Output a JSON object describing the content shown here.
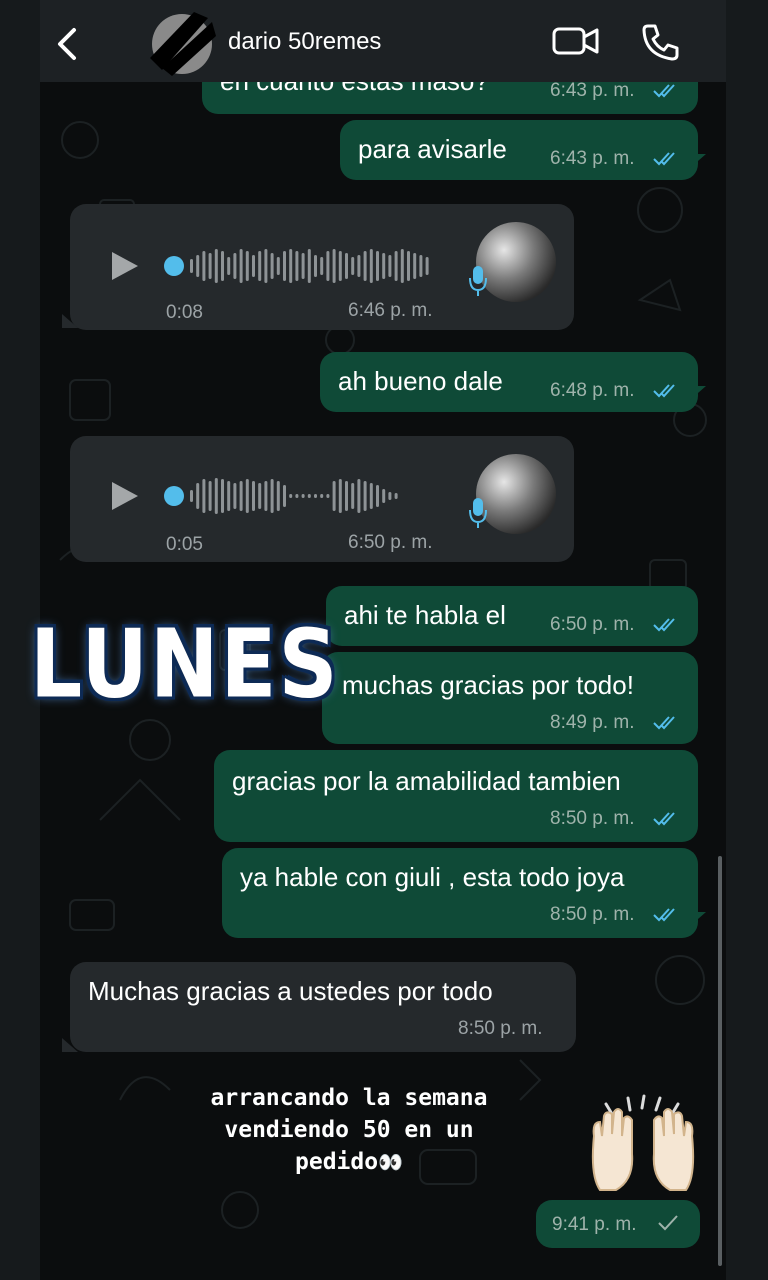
{
  "header": {
    "contact_name": "dario 50remes",
    "icons": {
      "back": "chevron-left-icon",
      "video": "video-camera-icon",
      "call": "phone-icon"
    }
  },
  "messages": [
    {
      "type": "text",
      "direction": "outgoing",
      "text": "en cuanto estas maso?",
      "time": "6:43 p. m.",
      "status": "read"
    },
    {
      "type": "text",
      "direction": "outgoing",
      "text": "para avisarle",
      "time": "6:43 p. m.",
      "status": "read"
    },
    {
      "type": "voice",
      "direction": "incoming",
      "duration": "0:08",
      "time": "6:46 p. m."
    },
    {
      "type": "text",
      "direction": "outgoing",
      "text": "ah bueno dale",
      "time": "6:48 p. m.",
      "status": "read"
    },
    {
      "type": "voice",
      "direction": "incoming",
      "duration": "0:05",
      "time": "6:50 p. m."
    },
    {
      "type": "text",
      "direction": "outgoing",
      "text": "ahi te habla el",
      "time": "6:50 p. m.",
      "status": "read"
    },
    {
      "type": "text",
      "direction": "outgoing",
      "text": "muchas gracias por todo!",
      "time": "8:49 p. m.",
      "status": "read"
    },
    {
      "type": "text",
      "direction": "outgoing",
      "text": "gracias por la amabilidad tambien",
      "time": "8:50 p. m.",
      "status": "read"
    },
    {
      "type": "text",
      "direction": "outgoing",
      "text": "ya hable con giuli , esta todo joya",
      "time": "8:50 p. m.",
      "status": "read"
    },
    {
      "type": "text",
      "direction": "incoming",
      "text": "Muchas gracias a ustedes por todo",
      "time": "8:50 p. m."
    },
    {
      "type": "sticker",
      "direction": "outgoing",
      "time": "9:41 p. m.",
      "status": "sent"
    }
  ],
  "overlay": {
    "sticker_text": "LUNES",
    "story_line1": "arrancando la semana",
    "story_line2": "vendiendo 50 en un",
    "story_line3": "pedido",
    "story_emoji": "👀"
  },
  "colors": {
    "outgoing_bubble": "#0f4a37",
    "incoming_bubble": "#25292c",
    "read_ticks": "#53bdeb",
    "header_bg": "#1d2124"
  }
}
